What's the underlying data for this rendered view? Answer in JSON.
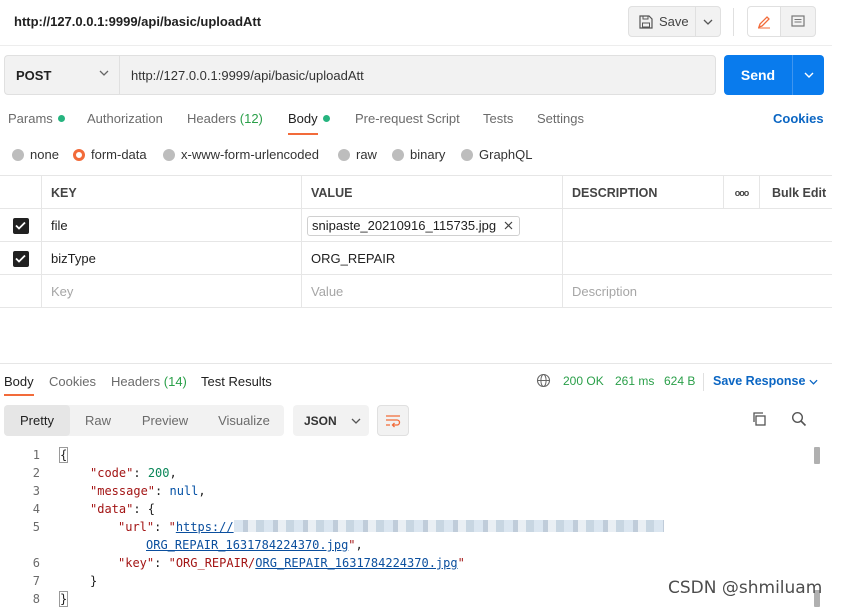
{
  "header": {
    "url_title": "http://127.0.0.1:9999/api/basic/uploadAtt",
    "save_label": "Save"
  },
  "request": {
    "method": "POST",
    "url": "http://127.0.0.1:9999/api/basic/uploadAtt",
    "send_label": "Send"
  },
  "request_tabs": {
    "params": "Params",
    "authorization": "Authorization",
    "headers": "Headers",
    "headers_count": "(12)",
    "body": "Body",
    "pre_request": "Pre-request Script",
    "tests": "Tests",
    "settings": "Settings",
    "cookies": "Cookies"
  },
  "body_types": {
    "none": "none",
    "form_data": "form-data",
    "urlencoded": "x-www-form-urlencoded",
    "raw": "raw",
    "binary": "binary",
    "graphql": "GraphQL",
    "selected": "form-data"
  },
  "kv_table": {
    "headers": {
      "key": "KEY",
      "value": "VALUE",
      "description": "DESCRIPTION",
      "more": "ooo",
      "bulk": "Bulk Edit"
    },
    "rows": [
      {
        "key": "file",
        "value": "snipaste_20210916_115735.jpg",
        "checked": true
      },
      {
        "key": "bizType",
        "value": "ORG_REPAIR",
        "checked": true
      }
    ],
    "placeholders": {
      "key": "Key",
      "value": "Value",
      "description": "Description"
    }
  },
  "response_tabs": {
    "body": "Body",
    "cookies": "Cookies",
    "headers": "Headers",
    "headers_count": "(14)",
    "test_results": "Test Results",
    "status": "200 OK",
    "time": "261 ms",
    "size": "624 B",
    "save_response": "Save Response"
  },
  "view_modes": {
    "pretty": "Pretty",
    "raw": "Raw",
    "preview": "Preview",
    "visualize": "Visualize",
    "format": "JSON"
  },
  "code": {
    "line_numbers": [
      "1",
      "2",
      "3",
      "4",
      "5",
      "",
      "6",
      "7",
      "8"
    ],
    "l1": "{",
    "code_key": "\"code\"",
    "code_val": "200",
    "message_key": "\"message\"",
    "message_val": "null",
    "data_key": "\"data\"",
    "url_key": "\"url\"",
    "url_prefix": "https://",
    "url_file": "ORG_REPAIR_1631784224370.jpg",
    "key_key": "\"key\"",
    "key_prefix": "ORG_REPAIR/",
    "key_file": "ORG_REPAIR_1631784224370.jpg",
    "l7": "}",
    "l8": "}"
  },
  "watermark": "CSDN @shmiluam",
  "colors": {
    "send_blue": "#097bed",
    "accent_orange": "#f26b3a",
    "status_green": "#2a9f49",
    "link_blue": "#0b66c3"
  }
}
